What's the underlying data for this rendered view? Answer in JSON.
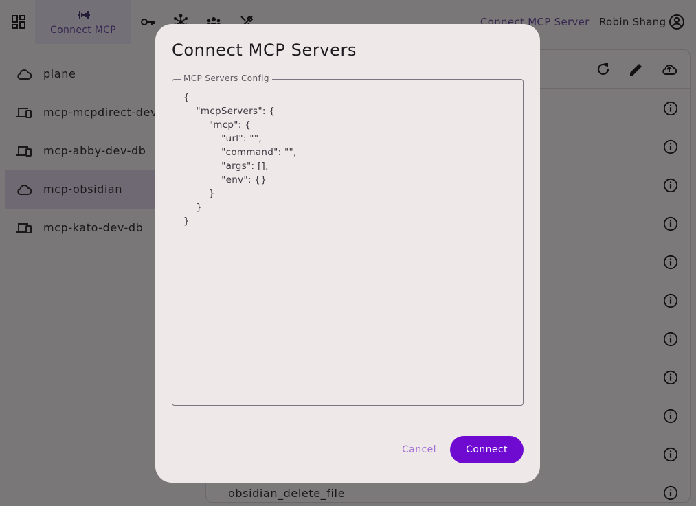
{
  "topbar": {
    "active_tab_label": "Connect MCP",
    "connect_link": "Connect MCP Server",
    "user_name": "Robin Shang"
  },
  "sidebar": {
    "items": [
      {
        "label": "plane",
        "icon": "cloud-icon"
      },
      {
        "label": "mcp-mcpdirect-dev-db",
        "icon": "devices-icon"
      },
      {
        "label": "mcp-abby-dev-db",
        "icon": "devices-icon"
      },
      {
        "label": "mcp-obsidian",
        "icon": "cloud-icon",
        "active": true
      },
      {
        "label": "mcp-kato-dev-db",
        "icon": "devices-icon"
      }
    ]
  },
  "main": {
    "last_tool_name": "obsidian_delete_file"
  },
  "dialog": {
    "title": "Connect MCP Servers",
    "config_label": "MCP Servers Config",
    "config_value": "{\n    \"mcpServers\": {\n        \"mcp\": {\n            \"url\": \"\",\n            \"command\": \"\",\n            \"args\": [],\n            \"env\": {}\n        }\n    }\n}",
    "cancel_label": "Cancel",
    "connect_label": "Connect"
  },
  "colors": {
    "accent": "#6f0bd1",
    "link": "#6b4ea0",
    "cancel_text": "#a26fd6"
  }
}
